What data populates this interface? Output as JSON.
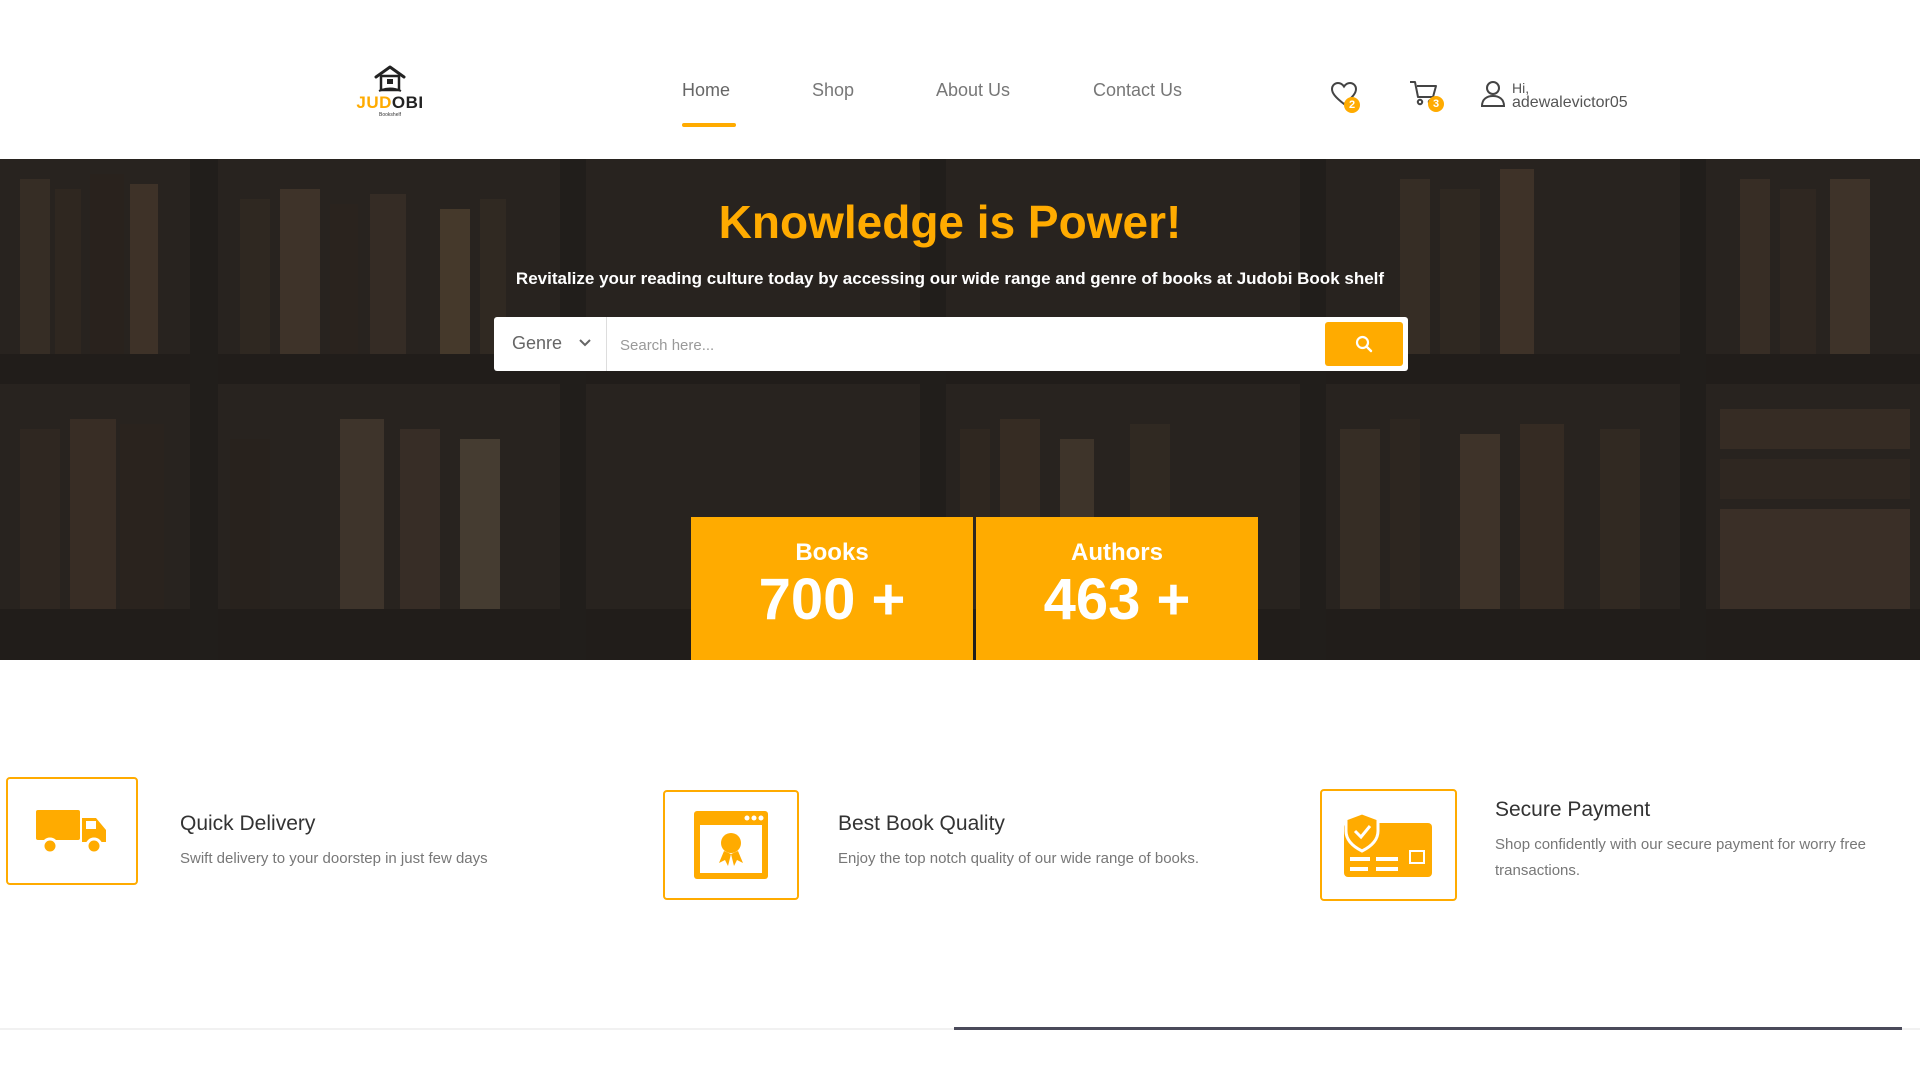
{
  "brand": {
    "name_part1": "JUD",
    "name_part2": "OBI",
    "tagline": "Bookshelf",
    "accent_color": "#FFAB00"
  },
  "nav": {
    "items": [
      {
        "label": "Home"
      },
      {
        "label": "Shop"
      },
      {
        "label": "About Us"
      },
      {
        "label": "Contact Us"
      }
    ],
    "active": "Home"
  },
  "header_icons": {
    "wishlist_count": "2",
    "cart_count": "3"
  },
  "user": {
    "greeting": "Hi,",
    "username": "adewalevictor05"
  },
  "hero": {
    "title": "Knowledge is Power!",
    "subtitle": "Revitalize your reading culture today by accessing our wide range and genre of books at Judobi Book shelf"
  },
  "search": {
    "genre_label": "Genre",
    "placeholder": "Search here..."
  },
  "stats": [
    {
      "label": "Books",
      "value": "700 +"
    },
    {
      "label": "Authors",
      "value": "463 +"
    }
  ],
  "features": [
    {
      "title": "Quick Delivery",
      "description": "Swift delivery to your doorstep in just few days",
      "icon": "truck-icon"
    },
    {
      "title": "Best Book Quality",
      "description": "Enjoy the top notch quality of our wide range of books.",
      "icon": "quality-badge-icon"
    },
    {
      "title": "Secure Payment",
      "description": "Shop confidently with our secure payment for worry free transactions.",
      "icon": "secure-card-icon"
    }
  ]
}
